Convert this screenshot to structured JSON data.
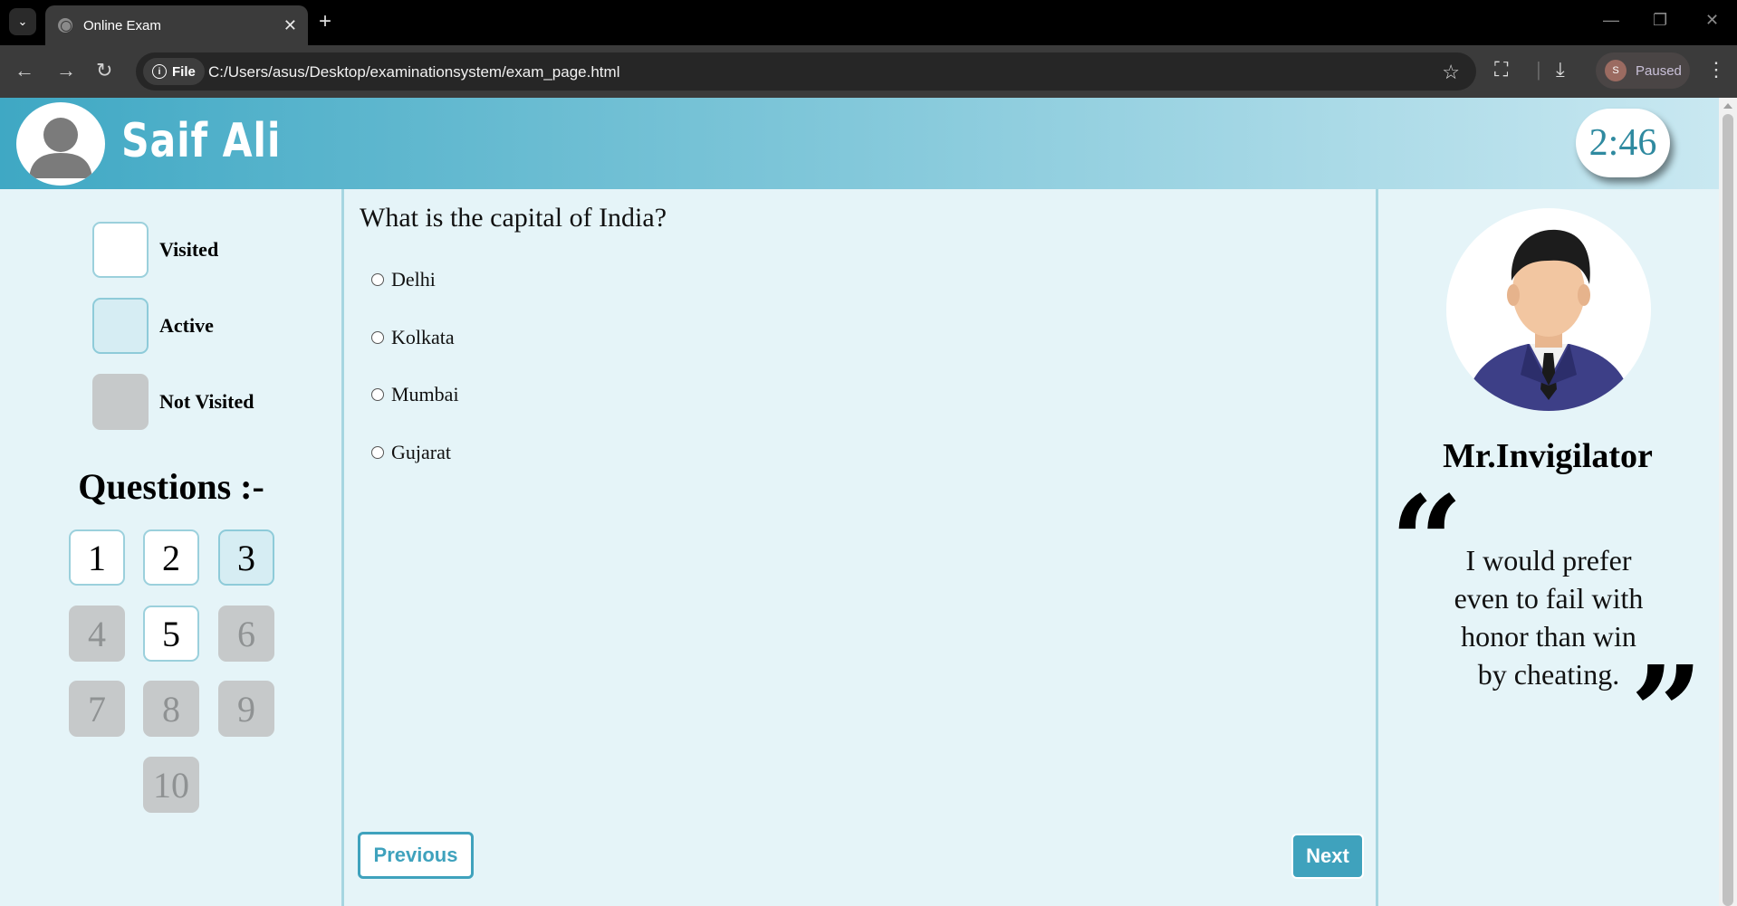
{
  "browser": {
    "tab_title": "Online Exam",
    "url_chip": "File",
    "url": "C:/Users/asus/Desktop/examinationsystem/exam_page.html",
    "profile_initial": "S",
    "profile_status": "Paused"
  },
  "header": {
    "student_name": "Saif Ali",
    "timer": "2:46"
  },
  "legend": {
    "visited": "Visited",
    "active": "Active",
    "not_visited": "Not Visited"
  },
  "questions_title": "Questions :-",
  "question_buttons": [
    {
      "label": "1",
      "state": "visited"
    },
    {
      "label": "2",
      "state": "visited"
    },
    {
      "label": "3",
      "state": "active"
    },
    {
      "label": "4",
      "state": "not_visited"
    },
    {
      "label": "5",
      "state": "visited"
    },
    {
      "label": "6",
      "state": "not_visited"
    },
    {
      "label": "7",
      "state": "not_visited"
    },
    {
      "label": "8",
      "state": "not_visited"
    },
    {
      "label": "9",
      "state": "not_visited"
    },
    {
      "label": "10",
      "state": "not_visited"
    }
  ],
  "question": {
    "text": "What is the capital of India?",
    "options": [
      "Delhi",
      "Kolkata",
      "Mumbai",
      "Gujarat"
    ]
  },
  "nav": {
    "previous": "Previous",
    "next": "Next"
  },
  "invigilator": {
    "name": "Mr.Invigilator",
    "quote_lines": [
      "I would prefer",
      "even to fail with",
      "honor than win",
      "by cheating."
    ]
  },
  "colors": {
    "accent": "#3fa2bd",
    "page_bg": "#e5f4f8"
  }
}
